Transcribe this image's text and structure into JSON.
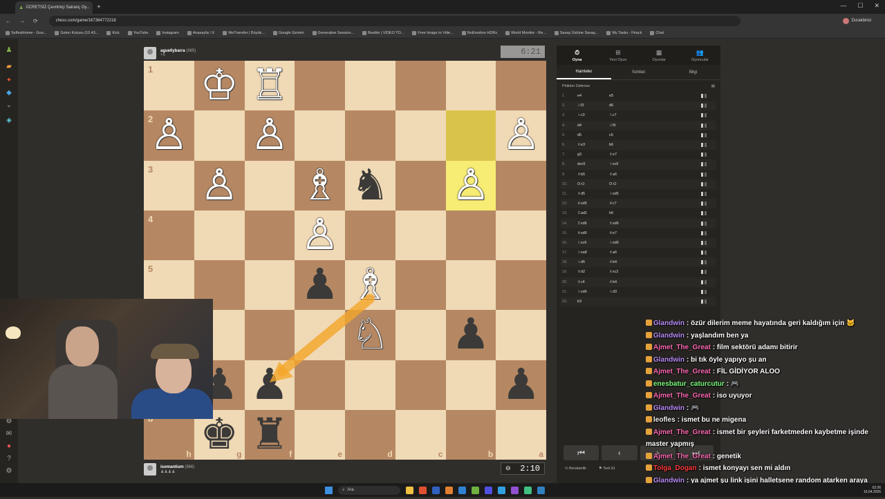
{
  "browser": {
    "tab_title": "ÜCRETSİZ Çevrimiçi Satranç Oy...",
    "url": "chess.com/game/167364772218",
    "profile_name": "Durakbirisi",
    "bookmarks": [
      "SelfestHome - Goo...",
      "Gelen Kutusu (10.43...",
      "Kick",
      "YouTube",
      "Instagram",
      "Anasayfa / X",
      "WeTransfer | Büyük...",
      "Google Gemini",
      "Generative Session...",
      "Beeble | VIDEO TO...",
      "Free Image to Vide...",
      "NoEmotion HDRs",
      "World Monitor - Re...",
      "Savaş Üstüne Savaş...",
      "My Tasks - Ftrack",
      "Chat"
    ]
  },
  "top_player": {
    "name": "aguellybarra",
    "rating": "(985)",
    "material": "+6",
    "clock": "6:21"
  },
  "bottom_player": {
    "name": "isomantium",
    "rating": "(966)",
    "clock": "2:10"
  },
  "board": {
    "rows": [
      [
        "",
        "♔",
        "♖",
        "",
        "",
        "",
        "",
        ""
      ],
      [
        "♙",
        "",
        "♙",
        "",
        "",
        "",
        "",
        "♙"
      ],
      [
        "",
        "♙",
        "",
        "♗",
        "♞",
        "",
        "♙",
        ""
      ],
      [
        "",
        "",
        "",
        "♙",
        "",
        "",
        "",
        ""
      ],
      [
        "",
        "",
        "",
        "♟",
        "♗",
        "",
        "",
        ""
      ],
      [
        "",
        "",
        "",
        "",
        "♘",
        "",
        "♟",
        ""
      ],
      [
        "",
        "♟",
        "♟",
        "",
        "",
        "",
        "",
        "♟"
      ],
      [
        "",
        "♚",
        "♜",
        "",
        "",
        "",
        "",
        ""
      ]
    ],
    "pieces_white": [
      "♔",
      "♖",
      "♙",
      "♗",
      "♘"
    ],
    "ranks": [
      "1",
      "2",
      "3",
      "4",
      "5",
      "6",
      "7",
      "8"
    ],
    "files": [
      "h",
      "g",
      "f",
      "e",
      "d",
      "c",
      "b",
      "a"
    ],
    "highlight_color_dark": "#dac34b",
    "highlight_color_light": "#f7ec74",
    "arrow_color": "#f4a62a"
  },
  "panel": {
    "tabs": [
      {
        "label": "Oyna",
        "icon": "stopwatch-icon"
      },
      {
        "label": "Yeni Oyun",
        "icon": "plus-icon"
      },
      {
        "label": "Oyunlar",
        "icon": "grid-icon"
      },
      {
        "label": "Oyuncular",
        "icon": "players-icon"
      }
    ],
    "subtabs": [
      "Hamleler",
      "Sohbet",
      "Bilgi"
    ],
    "opening": "Philidor Defense",
    "moves": [
      [
        "1.",
        "e4",
        "e5"
      ],
      [
        "2.",
        "♘f3",
        "d6"
      ],
      [
        "3.",
        "♘c3",
        "♘c7"
      ],
      [
        "4.",
        "d4",
        "♘f6"
      ],
      [
        "5.",
        "d5",
        "c6"
      ],
      [
        "6.",
        "♗e3",
        "b6"
      ],
      [
        "7.",
        "g3",
        "♗e7"
      ],
      [
        "8.",
        "dxc6",
        "♘xc6"
      ],
      [
        "9.",
        "♗b5",
        "♗a6"
      ],
      [
        "10.",
        "O-O",
        "O-O"
      ],
      [
        "11.",
        "♗d5",
        "♘xd5"
      ],
      [
        "12.",
        "♕xd5",
        "♕c7"
      ],
      [
        "13.",
        "♖ad1",
        "h6"
      ],
      [
        "14.",
        "♖xd6",
        "♗xd6"
      ],
      [
        "15.",
        "♕xd6",
        "♕e7"
      ],
      [
        "16.",
        "♘xc6",
        "♘xd6"
      ],
      [
        "17.",
        "♘xa8",
        "♗a6"
      ],
      [
        "18.",
        "♘d5",
        "♗b4"
      ],
      [
        "19.",
        "♗d2",
        "♗xc2"
      ],
      [
        "20.",
        "♗c4",
        "♗b4"
      ],
      [
        "21.",
        "♘xd6",
        "♘d3"
      ],
      [
        "22.",
        "b3",
        ""
      ]
    ],
    "nav": [
      "⏮",
      "‹",
      "›",
      "⏭"
    ],
    "actions": [
      "Beraberlik",
      "Terk Et"
    ]
  },
  "chat": [
    {
      "user": "Glandwin",
      "color": "#b98cf7",
      "text": ": özür dilerim meme hayatında geri kaldığım için 🐱"
    },
    {
      "user": "Glandwin",
      "color": "#b98cf7",
      "text": ": yaşlandım ben ya"
    },
    {
      "user": "Ajmet_The_Great",
      "color": "#ff6bb5",
      "text": ": film sektörü adamı bitirir"
    },
    {
      "user": "Glandwin",
      "color": "#b98cf7",
      "text": ": bi tık öyle yapıyo şu an"
    },
    {
      "user": "Ajmet_The_Great",
      "color": "#ff6bb5",
      "text": ": FİL GİDİYOR ALOO"
    },
    {
      "user": "enesbatur_caturcutur",
      "color": "#7cfc7c",
      "text": ": 🎮"
    },
    {
      "user": "Ajmet_The_Great",
      "color": "#ff6bb5",
      "text": ": iso uyuyor"
    },
    {
      "user": "Glandwin",
      "color": "#b98cf7",
      "text": ": 🎮"
    },
    {
      "user": "leofles",
      "color": "#f0f0f0",
      "text": ": ismet bu ne migena"
    },
    {
      "user": "Ajmet_The_Great",
      "color": "#ff6bb5",
      "text": ": ismet bir şeyleri farketmeden kaybetme işinde master yapmış"
    },
    {
      "user": "Ajmet_The_Great",
      "color": "#ff6bb5",
      "text": ": genetik"
    },
    {
      "user": "Tolga_Dogan",
      "color": "#ff3b3b",
      "text": ": ismet konyayı sen mi aldın"
    },
    {
      "user": "Glandwin",
      "color": "#b98cf7",
      "text": ": ya ajmet şu link işini halletsene random atarken araya nokta giriyo onu bile attırmıyo"
    }
  ],
  "taskbar": {
    "search_placeholder": "Ara",
    "time": "02:26",
    "date": "16.04.2026"
  }
}
